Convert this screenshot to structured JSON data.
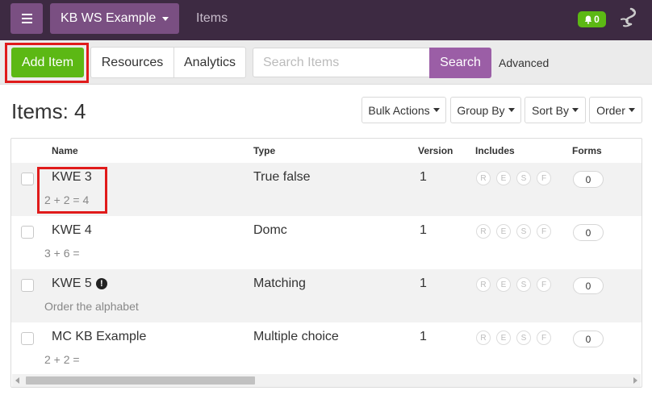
{
  "header": {
    "workspace": "KB WS Example",
    "nav_label": "Items",
    "notifications": "0"
  },
  "toolbar": {
    "add_item": "Add Item",
    "resources": "Resources",
    "analytics": "Analytics",
    "search_placeholder": "Search Items",
    "search_button": "Search",
    "advanced": "Advanced"
  },
  "page": {
    "title": "Items: 4",
    "actions": [
      "Bulk Actions",
      "Group By",
      "Sort By",
      "Order"
    ]
  },
  "table": {
    "columns": [
      "Name",
      "Type",
      "Version",
      "Includes",
      "Forms"
    ],
    "include_letters": [
      "R",
      "E",
      "S",
      "F"
    ],
    "rows": [
      {
        "name": "KWE 3",
        "desc": "2 + 2 = 4",
        "type": "True false",
        "version": "1",
        "forms": "0"
      },
      {
        "name": "KWE 4",
        "desc": "3 + 6 =",
        "type": "Domc",
        "version": "1",
        "forms": "0"
      },
      {
        "name": "KWE 5",
        "desc": "Order the alphabet",
        "type": "Matching",
        "version": "1",
        "forms": "0",
        "warning": "!"
      },
      {
        "name": "MC KB Example",
        "desc": "2 + 2 =",
        "type": "Multiple choice",
        "version": "1",
        "forms": "0"
      }
    ]
  },
  "colors": {
    "topbar": "#3d2a42",
    "accent_purple": "#9b5ea6",
    "green": "#5cb814",
    "highlight": "#e01b1b"
  },
  "icons": [
    "hamburger-icon",
    "bell-icon",
    "logo-icon",
    "exclamation-icon"
  ]
}
